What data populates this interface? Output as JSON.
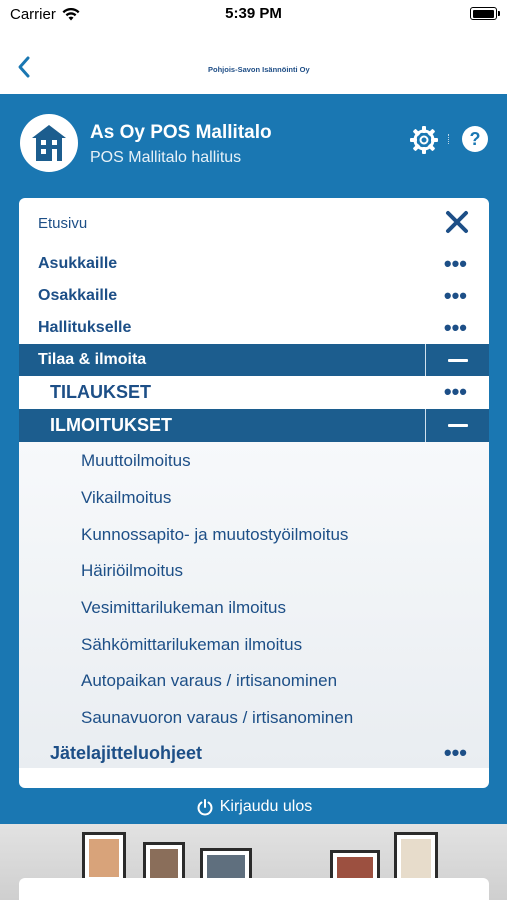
{
  "status_bar": {
    "carrier": "Carrier",
    "time": "5:39 PM"
  },
  "nav": {
    "logo_text": "Pohjois-Savon Isännöinti Oy"
  },
  "header": {
    "title": "As Oy POS Mallitalo",
    "subtitle": "POS Mallitalo hallitus"
  },
  "menu": {
    "home_label": "Etusivu",
    "items": [
      {
        "label": "Asukkaille"
      },
      {
        "label": "Osakkaille"
      },
      {
        "label": "Hallitukselle"
      },
      {
        "label": "Tilaa & ilmoita"
      }
    ],
    "subitems": [
      {
        "label": "TILAUKSET"
      },
      {
        "label": "ILMOITUKSET"
      }
    ],
    "notices": [
      "Muuttoilmoitus",
      "Vikailmoitus",
      "Kunnossapito- ja muutostyöilmoitus",
      "Häiriöilmoitus",
      "Vesimittarilukeman ilmoitus",
      "Sähkömittarilukeman ilmoitus",
      "Autopaikan varaus / irtisanominen",
      "Saunavuoron varaus / irtisanominen"
    ],
    "waste_label": "Jätelajitteluohjeet"
  },
  "logout_label": "Kirjaudu ulos",
  "colors": {
    "brand_blue": "#1a77b2",
    "menu_text": "#1d4f87",
    "active_row": "#1c5d8e"
  }
}
